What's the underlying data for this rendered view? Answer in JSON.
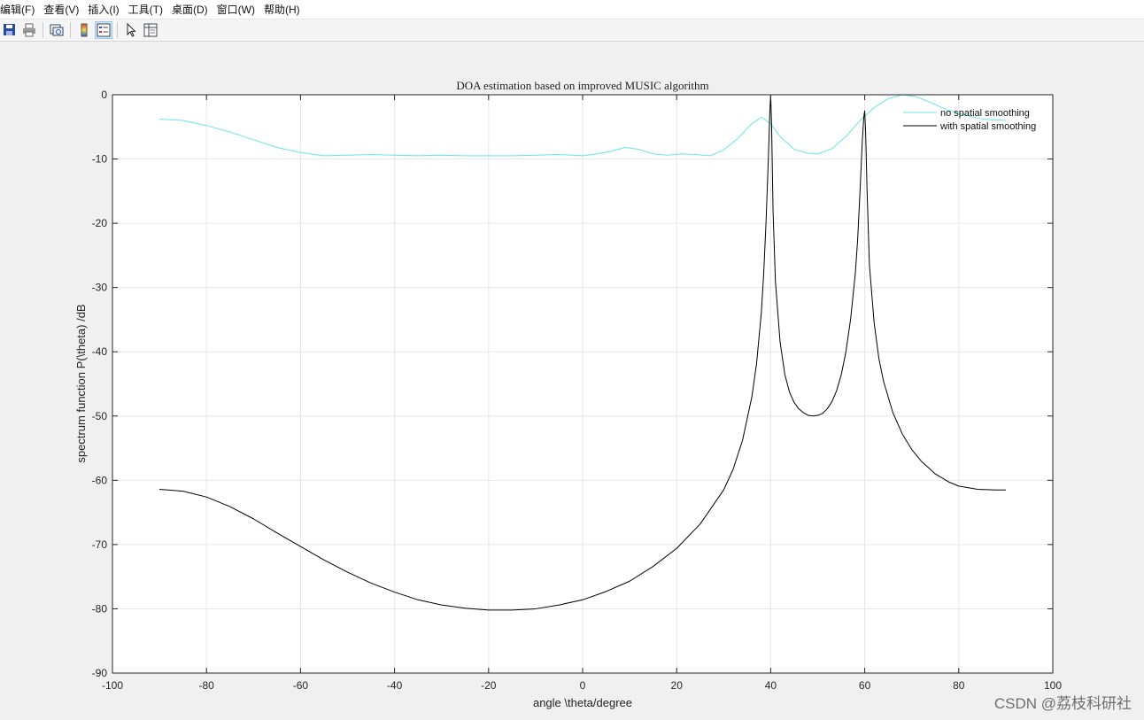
{
  "menu": {
    "items": [
      "编辑(F)",
      "查看(V)",
      "插入(I)",
      "工具(T)",
      "桌面(D)",
      "窗口(W)",
      "帮助(H)"
    ]
  },
  "toolbar": {
    "icons": [
      "save-icon",
      "print-icon",
      "link-plot-icon",
      "insert-colorbar-icon",
      "insert-legend-icon",
      "select-arrow-icon",
      "property-inspector-icon"
    ]
  },
  "watermark": "CSDN @荔枝科研社",
  "chart_data": {
    "type": "line",
    "title": "DOA estimation based on improved MUSIC algorithm",
    "xlabel": "angle \\theta/degree",
    "ylabel": "spectrum function P(\\theta) /dB",
    "xlim": [
      -100,
      100
    ],
    "ylim": [
      -90,
      0
    ],
    "xticks": [
      -100,
      -80,
      -60,
      -40,
      -20,
      0,
      20,
      40,
      60,
      80,
      100
    ],
    "yticks": [
      0,
      -10,
      -20,
      -30,
      -40,
      -50,
      -60,
      -70,
      -80,
      -90
    ],
    "grid": true,
    "legend_position": "top-right",
    "series": [
      {
        "name": "no spatial smoothing",
        "color": "#66e6e6",
        "x": [
          -90,
          -85,
          -80,
          -75,
          -70,
          -65,
          -60,
          -55,
          -50,
          -45,
          -40,
          -35,
          -30,
          -25,
          -20,
          -15,
          -10,
          -5,
          0,
          3,
          6,
          9,
          12,
          15,
          18,
          21,
          24,
          27,
          30,
          33,
          36,
          38,
          40,
          42,
          45,
          48,
          50,
          53,
          56,
          59,
          62,
          65,
          68,
          71,
          74,
          77,
          80,
          85,
          90
        ],
        "y": [
          -3.8,
          -4.0,
          -4.8,
          -5.8,
          -7.0,
          -8.2,
          -9.0,
          -9.5,
          -9.4,
          -9.3,
          -9.4,
          -9.5,
          -9.4,
          -9.5,
          -9.5,
          -9.5,
          -9.4,
          -9.3,
          -9.5,
          -9.2,
          -8.8,
          -8.2,
          -8.5,
          -9.2,
          -9.4,
          -9.2,
          -9.3,
          -9.5,
          -8.6,
          -6.8,
          -4.5,
          -3.5,
          -4.5,
          -6.5,
          -8.5,
          -9.1,
          -9.2,
          -8.4,
          -6.5,
          -4.0,
          -2.0,
          -0.6,
          0,
          -0.3,
          -1.2,
          -2.2,
          -2.9,
          -3.8,
          -4.0
        ]
      },
      {
        "name": "with spatial smoothing",
        "color": "#000000",
        "x": [
          -90,
          -85,
          -80,
          -75,
          -70,
          -65,
          -60,
          -55,
          -50,
          -45,
          -40,
          -35,
          -30,
          -25,
          -20,
          -15,
          -10,
          -5,
          0,
          5,
          10,
          15,
          20,
          25,
          30,
          32,
          34,
          36,
          37,
          38,
          38.5,
          39,
          39.5,
          39.8,
          40,
          40.2,
          40.5,
          41,
          42,
          43,
          44,
          45,
          46,
          47,
          48,
          49,
          50,
          51,
          52,
          53,
          54,
          55,
          56,
          57,
          58,
          58.5,
          59,
          59.5,
          59.8,
          60,
          60.2,
          60.5,
          61,
          62,
          63,
          64,
          66,
          68,
          70,
          72,
          75,
          78,
          80,
          84,
          88,
          90
        ],
        "y": [
          -61.4,
          -61.7,
          -62.6,
          -64.1,
          -66.0,
          -68.2,
          -70.3,
          -72.4,
          -74.3,
          -76.0,
          -77.4,
          -78.6,
          -79.4,
          -79.9,
          -80.2,
          -80.2,
          -80.0,
          -79.4,
          -78.6,
          -77.3,
          -75.7,
          -73.4,
          -70.6,
          -66.8,
          -61.5,
          -58.3,
          -53.8,
          -47.0,
          -41.8,
          -34.0,
          -28.0,
          -20.0,
          -10.0,
          -3.0,
          0,
          -5.0,
          -18.0,
          -29.0,
          -38.5,
          -43.5,
          -46.3,
          -47.9,
          -48.9,
          -49.5,
          -49.9,
          -50.0,
          -49.9,
          -49.6,
          -48.9,
          -47.8,
          -46.1,
          -43.6,
          -40.0,
          -34.9,
          -27.8,
          -22.5,
          -15.0,
          -7.0,
          -3.5,
          -2.5,
          -6.0,
          -15.0,
          -26.5,
          -35.5,
          -41.0,
          -44.6,
          -49.5,
          -52.8,
          -55.2,
          -57.0,
          -59.0,
          -60.3,
          -60.9,
          -61.4,
          -61.5,
          -61.5
        ]
      }
    ]
  }
}
